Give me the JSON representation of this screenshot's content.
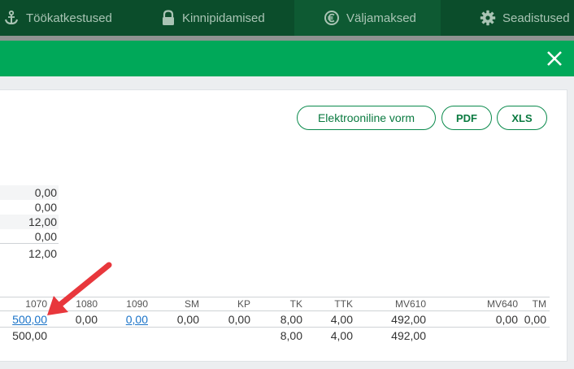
{
  "nav": {
    "tabs": [
      {
        "label": "Töökatkestused",
        "icon": "anchor-icon"
      },
      {
        "label": "Kinnipidamised",
        "icon": "lock-icon"
      },
      {
        "label": "Väljamaksed",
        "icon": "coin-icon",
        "active": true
      },
      {
        "label": "Seadistused",
        "icon": "gear-icon"
      }
    ]
  },
  "buttons": {
    "e_form": "Elektrooniline vorm",
    "pdf": "PDF",
    "xls": "XLS"
  },
  "summary": {
    "values": [
      "0,00",
      "0,00",
      "12,00",
      "0,00"
    ],
    "total": "12,00"
  },
  "table": {
    "headers": [
      "1070",
      "1080",
      "1090",
      "SM",
      "KP",
      "TK",
      "TTK",
      "MV610",
      "MV640",
      "TM"
    ],
    "row": [
      "500,00",
      "0,00",
      "0,00",
      "0,00",
      "0,00",
      "8,00",
      "4,00",
      "492,00",
      "0,00",
      "0,00"
    ],
    "totals": [
      "500,00",
      "",
      "",
      "",
      "",
      "8,00",
      "4,00",
      "492,00",
      "",
      ""
    ]
  },
  "colors": {
    "nav_bg": "#0b4d2b",
    "accent_green": "#00a859",
    "link_blue": "#1a73c8",
    "arrow_red": "#e8373c"
  }
}
